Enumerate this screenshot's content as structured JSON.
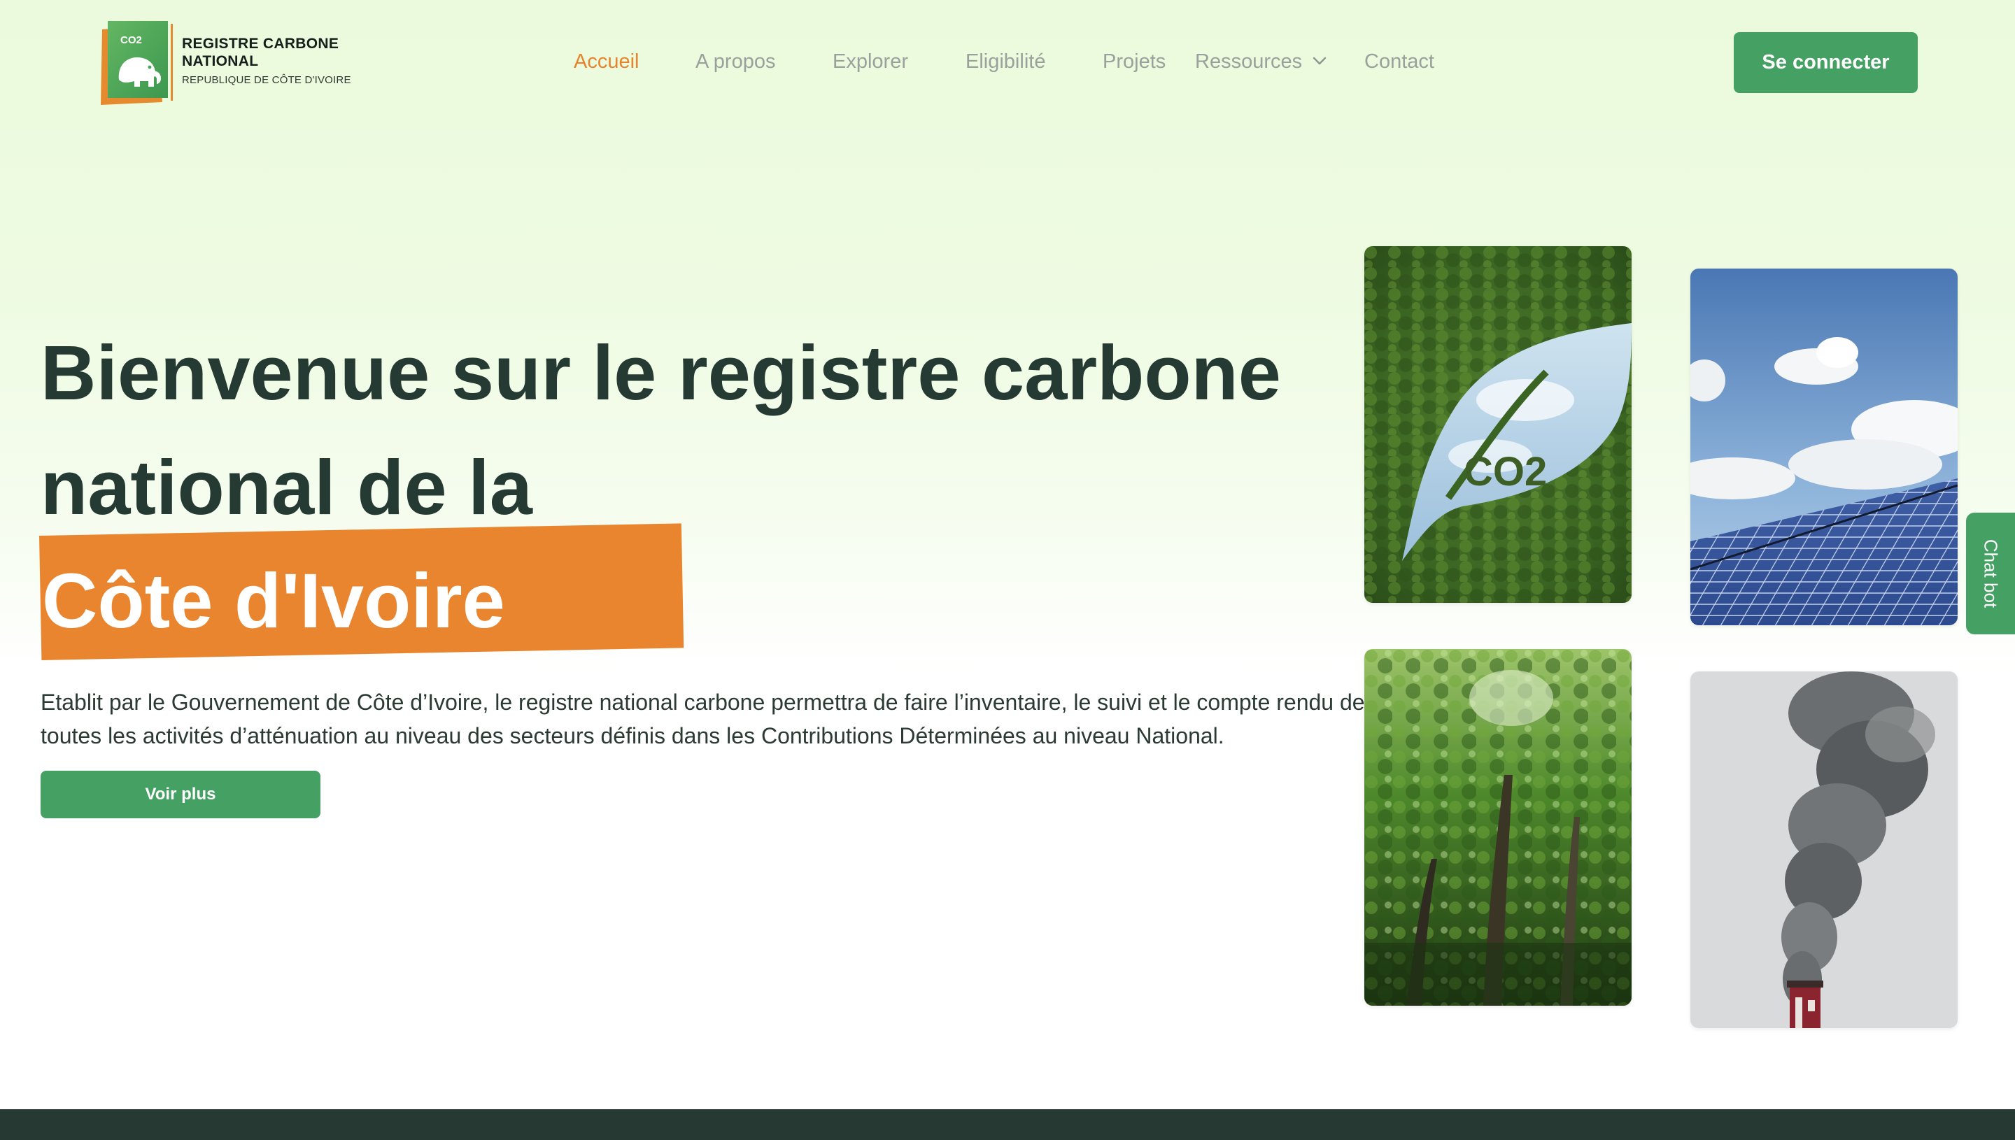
{
  "header": {
    "logo": {
      "line1": "REGISTRE CARBONE",
      "line2": "NATIONAL",
      "line3": "REPUBLIQUE DE CÔTE D'IVOIRE",
      "mark_text": "CO2"
    },
    "nav": [
      {
        "label": "Accueil",
        "active": true
      },
      {
        "label": "A propos",
        "active": false
      },
      {
        "label": "Explorer",
        "active": false
      },
      {
        "label": "Eligibilité",
        "active": false
      },
      {
        "label": "Projets",
        "active": false
      },
      {
        "label": "Ressources",
        "active": false,
        "icon": "chevron-down-icon"
      },
      {
        "label": "Contact",
        "active": false
      }
    ],
    "login_label": "Se connecter"
  },
  "hero": {
    "title": "Bienvenue sur le registre carbone national de la",
    "highlight": "Côte d'Ivoire",
    "description": "Etablit par le Gouvernement de Côte d’Ivoire, le registre national carbone permettra de faire l’inventaire, le suivi et le compte rendu de toutes les activités d’atténuation au niveau des secteurs définis dans les Contributions Déterminées au niveau National.",
    "more_label": "Voir plus"
  },
  "images": {
    "forest_co2_text": "CO2"
  },
  "chatbot": {
    "label": "Chat bot"
  },
  "colors": {
    "accent_green": "#44a063",
    "accent_orange": "#e9852f",
    "title_dark": "#253a33",
    "footer": "#263a33"
  }
}
